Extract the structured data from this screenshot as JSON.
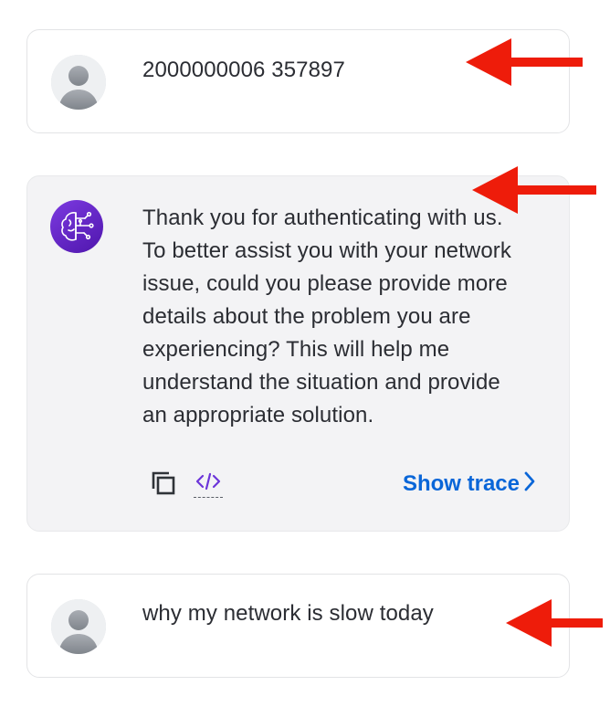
{
  "conversation": {
    "messages": [
      {
        "role": "user",
        "text": "2000000006 357897"
      },
      {
        "role": "assistant",
        "lines": [
          "Thank you for authenticating with us.",
          "To better assist you with your network",
          "issue, could you please provide more",
          "details about the problem you are",
          "experiencing? This will help me",
          "understand the situation and provide",
          "an appropriate solution."
        ],
        "actions": {
          "show_trace_label": "Show trace"
        }
      },
      {
        "role": "user",
        "text": "why my network is slow today"
      }
    ]
  },
  "icons": {
    "user_avatar": "user-avatar-icon",
    "bot_avatar": "ai-brain-icon",
    "copy": "copy-icon",
    "code": "code-icon",
    "chevron": "chevron-right-icon",
    "annotation": "red-arrow-icon"
  },
  "colors": {
    "link": "#0a66d8",
    "bot_bubble": "#f3f3f5",
    "bot_avatar": "#6a28cf",
    "annotation_arrow": "#ee1c0a"
  }
}
